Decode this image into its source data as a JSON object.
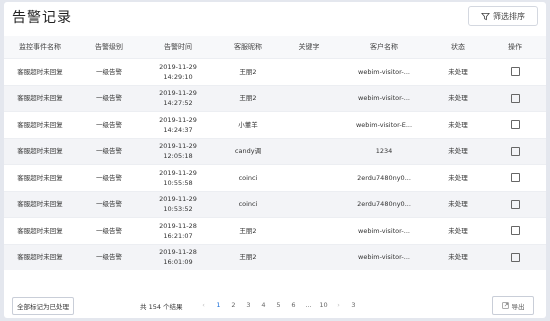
{
  "header": {
    "title": "告警记录",
    "filter_label": "筛选排序"
  },
  "table": {
    "columns": [
      "监控事件名称",
      "告警级别",
      "告警时间",
      "客服昵称",
      "关键字",
      "客户名称",
      "状态",
      "操作"
    ],
    "rows": [
      {
        "event": "客服超时未回复",
        "level": "一级告警",
        "date": "2019-11-29",
        "time": "14:29:10",
        "agent": "王丽2",
        "keyword": "",
        "customer": "webim-visitor-...",
        "status": "未处理"
      },
      {
        "event": "客服超时未回复",
        "level": "一级告警",
        "date": "2019-11-29",
        "time": "14:27:52",
        "agent": "王丽2",
        "keyword": "",
        "customer": "webim-visitor-...",
        "status": "未处理"
      },
      {
        "event": "客服超时未回复",
        "level": "一级告警",
        "date": "2019-11-29",
        "time": "14:24:37",
        "agent": "小董羊",
        "keyword": "",
        "customer": "webim-visitor-E...",
        "status": "未处理"
      },
      {
        "event": "客服超时未回复",
        "level": "一级告警",
        "date": "2019-11-29",
        "time": "12:05:18",
        "agent": "candy调",
        "keyword": "",
        "customer": "1234",
        "status": "未处理"
      },
      {
        "event": "客服超时未回复",
        "level": "一级告警",
        "date": "2019-11-29",
        "time": "10:55:58",
        "agent": "coinci",
        "keyword": "",
        "customer": "2erdu7480ny0...",
        "status": "未处理"
      },
      {
        "event": "客服超时未回复",
        "level": "一级告警",
        "date": "2019-11-29",
        "time": "10:53:52",
        "agent": "coinci",
        "keyword": "",
        "customer": "2erdu7480ny0...",
        "status": "未处理"
      },
      {
        "event": "客服超时未回复",
        "level": "一级告警",
        "date": "2019-11-28",
        "time": "16:21:07",
        "agent": "王丽2",
        "keyword": "",
        "customer": "webim-visitor-...",
        "status": "未处理"
      },
      {
        "event": "客服超时未回复",
        "level": "一级告警",
        "date": "2019-11-28",
        "time": "16:01:09",
        "agent": "王丽2",
        "keyword": "",
        "customer": "webim-visitor-...",
        "status": "未处理"
      }
    ]
  },
  "footer": {
    "mark_all_label": "全部标记为已处理",
    "total_text": "共 154 个结果",
    "pages": [
      "1",
      "2",
      "3",
      "4",
      "5",
      "6",
      "...",
      "10"
    ],
    "active_page": "1",
    "jump_value": "3",
    "export_label": "导出"
  },
  "colors": {
    "accent": "#1a6fd8",
    "background": "#e4e7ee"
  }
}
